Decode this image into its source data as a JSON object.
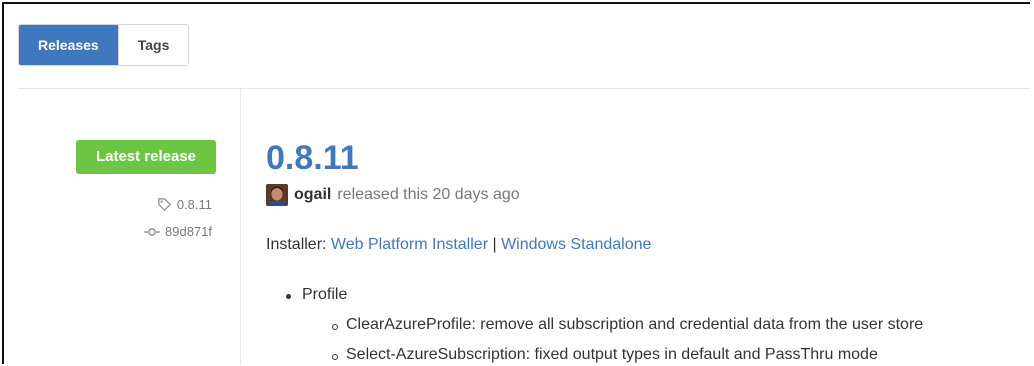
{
  "tabs": [
    {
      "label": "Releases",
      "active": true
    },
    {
      "label": "Tags",
      "active": false
    }
  ],
  "sidebar": {
    "badge": "Latest release",
    "tag": "0.8.11",
    "commit": "89d871f",
    "tag_icon": "tag-icon",
    "commit_icon": "commit-icon"
  },
  "release": {
    "version": "0.8.11",
    "author": "ogail",
    "released_text": "released this 20 days ago",
    "installer_label": "Installer:",
    "links": [
      "Web Platform Installer",
      "Windows Standalone"
    ],
    "separator": "|",
    "items": [
      {
        "label": "Profile",
        "subitems": [
          "ClearAzureProfile: remove all subscription and credential data from the user store",
          "Select-AzureSubscription: fixed output types in default and PassThru mode"
        ]
      }
    ]
  },
  "colors": {
    "accent": "#4078c0",
    "latest_badge": "#6cc644",
    "muted": "#777777"
  }
}
